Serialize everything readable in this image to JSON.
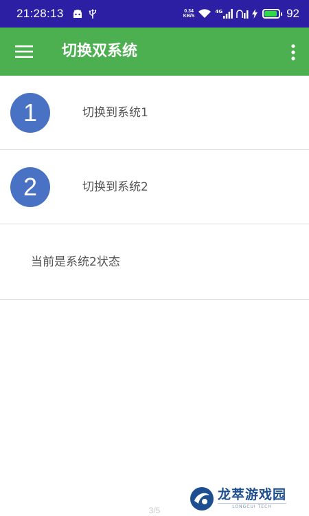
{
  "status_bar": {
    "time": "21:28:13",
    "net_speed_value": "0.34",
    "net_speed_unit": "KB/S",
    "network_label": "4G",
    "battery_level": 92,
    "battery_text": "92"
  },
  "app_bar": {
    "title": "切换双系统",
    "background_color": "#4caf50"
  },
  "list": {
    "items": [
      {
        "badge": "1",
        "label": "切换到系统1"
      },
      {
        "badge": "2",
        "label": "切换到系统2"
      }
    ],
    "status_text": "当前是系统2状态"
  },
  "footer": {
    "page_indicator": "3/5"
  },
  "watermark": {
    "name": "龙萃游戏园",
    "sub": "LONGCUI TECH"
  },
  "colors": {
    "status_bar": "#2c1fa3",
    "badge": "#4a72c4",
    "battery": "#31d84a"
  }
}
